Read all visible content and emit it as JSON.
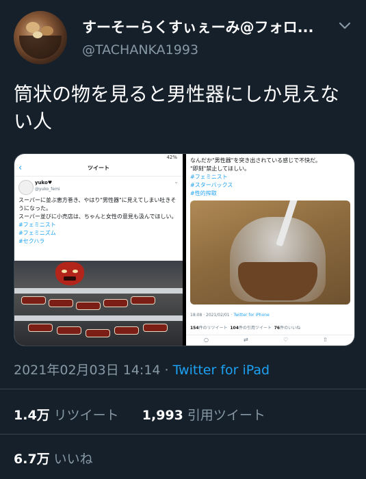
{
  "header": {
    "display_name": "すーそーらくすぃぇーみ@フォロ...",
    "handle": "@TACHANKA1993",
    "avatar_icon": "profile-food-photo",
    "menu_icon": "chevron-down-icon"
  },
  "tweet": {
    "text": "筒状の物を見ると男性器にしか見えない人"
  },
  "embedded_left": {
    "status_battery": "42%",
    "nav_title": "ツイート",
    "author_name": "yuko♥",
    "author_handle": "@yuko_femi",
    "body_lines": [
      "スーパーに並ぶ恵方巻き、やはり\"男性器\"に見えてしまい吐きそうになった。",
      "スーパー並びに小売店は、ちゃんと女性の意見も汲んでほしい。"
    ],
    "tags": [
      "#フェミニスト",
      "#フェミニズム",
      "#セクハラ"
    ]
  },
  "embedded_right": {
    "body_lines": [
      "なんだか\"男性器\"を突き出されている感じで不快だ。",
      "\"即刻\"禁止してほしい。"
    ],
    "tags": [
      "#フェミニスト",
      "#スターバックス",
      "#性的搾取"
    ],
    "meta_time": "18:08 · 2021/02/01 · ",
    "meta_source": "Twitter for iPhone",
    "retweets_num": "154",
    "retweets_label": "件のリツイート",
    "quotes_num": "104",
    "quotes_label": "件の引用ツイート",
    "likes_num": "76",
    "likes_label": "件のいいね"
  },
  "timestamp": {
    "date_time": "2021年02月03日 14:14 · ",
    "source": "Twitter for iPad"
  },
  "stats": {
    "retweets_value": "1.4万",
    "retweets_label": "リツイート",
    "quotes_value": "1,993",
    "quotes_label": "引用ツイート",
    "likes_value": "6.7万",
    "likes_label": "いいね"
  },
  "colors": {
    "background": "#15202b",
    "accent": "#1da1f2",
    "secondary_text": "#8899a6",
    "divider": "#38444d"
  }
}
